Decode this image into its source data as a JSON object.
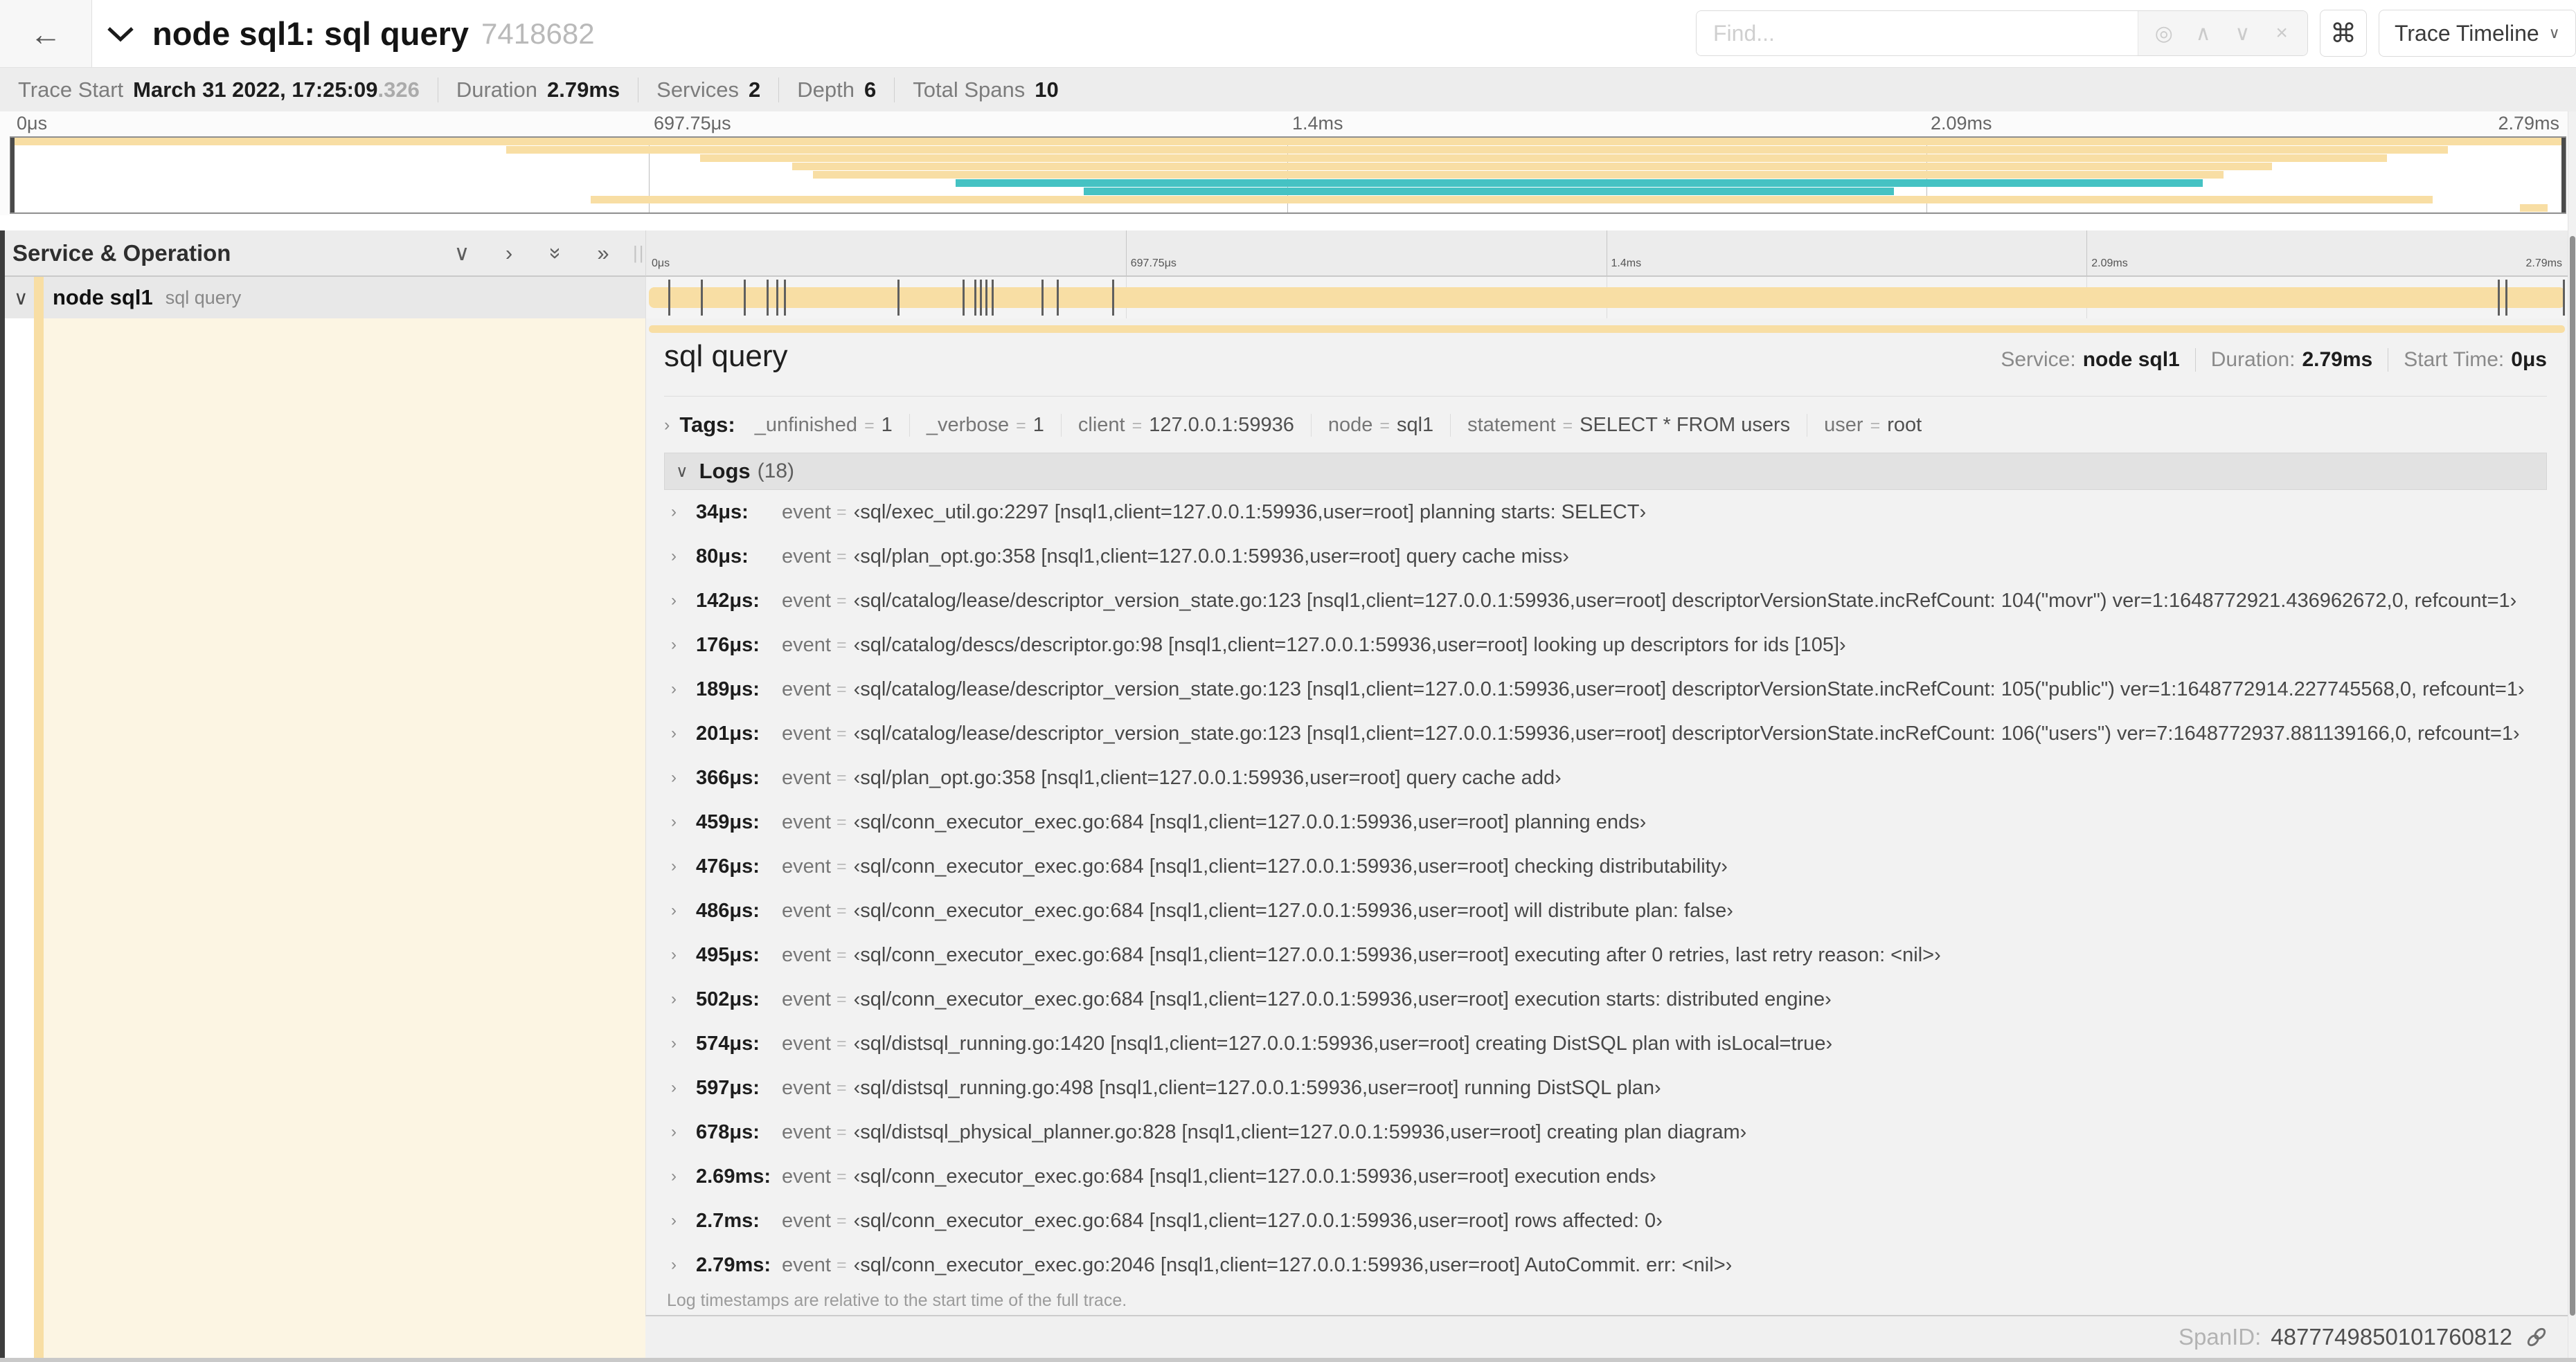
{
  "colors": {
    "tan": "#F8DEA4",
    "teal": "#45C2C3",
    "cream": "#FCF5E3"
  },
  "icons": {
    "back": "←",
    "chevron_down": "∨",
    "chevron_right": "›",
    "double_chevron_right": "»",
    "target": "◎",
    "up": "∧",
    "down": "∨",
    "close": "×",
    "command": "⌘",
    "caret": "∨",
    "grip": "||"
  },
  "header": {
    "title": "node sql1: sql query",
    "trace_id": "7418682",
    "find_placeholder": "Find...",
    "view_selector": "Trace Timeline"
  },
  "summary": {
    "items": [
      {
        "label": "Trace Start",
        "value": "March 31 2022, 17:25:09",
        "suffix": ".326"
      },
      {
        "label": "Duration",
        "value": "2.79ms"
      },
      {
        "label": "Services",
        "value": "2"
      },
      {
        "label": "Depth",
        "value": "6"
      },
      {
        "label": "Total Spans",
        "value": "10"
      }
    ]
  },
  "timeline": {
    "ticks": [
      {
        "label": "0μs",
        "pct": 0
      },
      {
        "label": "697.75μs",
        "pct": 25
      },
      {
        "label": "1.4ms",
        "pct": 50
      },
      {
        "label": "2.09ms",
        "pct": 75
      },
      {
        "label": "2.79ms",
        "pct": 100
      }
    ],
    "event_marks_pct": [
      1.2,
      2.9,
      5.1,
      6.3,
      6.8,
      7.2,
      13.1,
      16.5,
      17.1,
      17.4,
      17.7,
      18.0,
      20.6,
      21.4,
      24.3,
      96.4,
      96.8,
      99.8
    ]
  },
  "minimap": {
    "spans": [
      {
        "row": 0,
        "start_pct": 0,
        "end_pct": 100,
        "color": "tan"
      },
      {
        "row": 1,
        "start_pct": 19.4,
        "end_pct": 95.4,
        "color": "tan"
      },
      {
        "row": 2,
        "start_pct": 27,
        "end_pct": 93,
        "color": "tan"
      },
      {
        "row": 3,
        "start_pct": 30.6,
        "end_pct": 88.5,
        "color": "tan"
      },
      {
        "row": 4,
        "start_pct": 31.4,
        "end_pct": 86.6,
        "color": "tan"
      },
      {
        "row": 5,
        "start_pct": 37,
        "end_pct": 85.8,
        "color": "teal"
      },
      {
        "row": 6,
        "start_pct": 42,
        "end_pct": 73.7,
        "color": "teal"
      },
      {
        "row": 7,
        "start_pct": 22.7,
        "end_pct": 94.8,
        "color": "tan"
      },
      {
        "row": 8,
        "start_pct": 98.2,
        "end_pct": 99.3,
        "color": "tan"
      }
    ]
  },
  "table_header": {
    "label": "Service & Operation"
  },
  "span_row": {
    "service": "node sql1",
    "operation": "sql query"
  },
  "detail": {
    "operation": "sql query",
    "service_label": "Service:",
    "service": "node sql1",
    "duration_label": "Duration:",
    "duration": "2.79ms",
    "start_label": "Start Time:",
    "start": "0μs",
    "tags_label": "Tags:",
    "tags": [
      {
        "key": "_unfinished",
        "value": "1"
      },
      {
        "key": "_verbose",
        "value": "1"
      },
      {
        "key": "client",
        "value": "127.0.0.1:59936"
      },
      {
        "key": "node",
        "value": "sql1"
      },
      {
        "key": "statement",
        "value": "SELECT * FROM users"
      },
      {
        "key": "user",
        "value": "root"
      }
    ],
    "logs_label": "Logs",
    "logs_count": "(18)",
    "logs": [
      {
        "time": "34μs:",
        "field": "event",
        "value": "‹sql/exec_util.go:2297 [nsql1,client=127.0.0.1:59936,user=root] planning starts: SELECT›"
      },
      {
        "time": "80μs:",
        "field": "event",
        "value": "‹sql/plan_opt.go:358 [nsql1,client=127.0.0.1:59936,user=root] query cache miss›"
      },
      {
        "time": "142μs:",
        "field": "event",
        "value": "‹sql/catalog/lease/descriptor_version_state.go:123 [nsql1,client=127.0.0.1:59936,user=root] descriptorVersionState.incRefCount: 104(\"movr\") ver=1:1648772921.436962672,0, refcount=1›"
      },
      {
        "time": "176μs:",
        "field": "event",
        "value": "‹sql/catalog/descs/descriptor.go:98 [nsql1,client=127.0.0.1:59936,user=root] looking up descriptors for ids [105]›"
      },
      {
        "time": "189μs:",
        "field": "event",
        "value": "‹sql/catalog/lease/descriptor_version_state.go:123 [nsql1,client=127.0.0.1:59936,user=root] descriptorVersionState.incRefCount: 105(\"public\") ver=1:1648772914.227745568,0, refcount=1›"
      },
      {
        "time": "201μs:",
        "field": "event",
        "value": "‹sql/catalog/lease/descriptor_version_state.go:123 [nsql1,client=127.0.0.1:59936,user=root] descriptorVersionState.incRefCount: 106(\"users\") ver=7:1648772937.881139166,0, refcount=1›"
      },
      {
        "time": "366μs:",
        "field": "event",
        "value": "‹sql/plan_opt.go:358 [nsql1,client=127.0.0.1:59936,user=root] query cache add›"
      },
      {
        "time": "459μs:",
        "field": "event",
        "value": "‹sql/conn_executor_exec.go:684 [nsql1,client=127.0.0.1:59936,user=root] planning ends›"
      },
      {
        "time": "476μs:",
        "field": "event",
        "value": "‹sql/conn_executor_exec.go:684 [nsql1,client=127.0.0.1:59936,user=root] checking distributability›"
      },
      {
        "time": "486μs:",
        "field": "event",
        "value": "‹sql/conn_executor_exec.go:684 [nsql1,client=127.0.0.1:59936,user=root] will distribute plan: false›"
      },
      {
        "time": "495μs:",
        "field": "event",
        "value": "‹sql/conn_executor_exec.go:684 [nsql1,client=127.0.0.1:59936,user=root] executing after 0 retries, last retry reason: <nil>›"
      },
      {
        "time": "502μs:",
        "field": "event",
        "value": "‹sql/conn_executor_exec.go:684 [nsql1,client=127.0.0.1:59936,user=root] execution starts: distributed engine›"
      },
      {
        "time": "574μs:",
        "field": "event",
        "value": "‹sql/distsql_running.go:1420 [nsql1,client=127.0.0.1:59936,user=root] creating DistSQL plan with isLocal=true›"
      },
      {
        "time": "597μs:",
        "field": "event",
        "value": "‹sql/distsql_running.go:498 [nsql1,client=127.0.0.1:59936,user=root] running DistSQL plan›"
      },
      {
        "time": "678μs:",
        "field": "event",
        "value": "‹sql/distsql_physical_planner.go:828 [nsql1,client=127.0.0.1:59936,user=root] creating plan diagram›"
      },
      {
        "time": "2.69ms:",
        "field": "event",
        "value": "‹sql/conn_executor_exec.go:684 [nsql1,client=127.0.0.1:59936,user=root] execution ends›"
      },
      {
        "time": "2.7ms:",
        "field": "event",
        "value": "‹sql/conn_executor_exec.go:684 [nsql1,client=127.0.0.1:59936,user=root] rows affected: 0›"
      },
      {
        "time": "2.79ms:",
        "field": "event",
        "value": "‹sql/conn_executor_exec.go:2046 [nsql1,client=127.0.0.1:59936,user=root] AutoCommit. err: <nil>›"
      }
    ],
    "logs_note": "Log timestamps are relative to the start time of the full trace.",
    "spanid_label": "SpanID:",
    "spanid": "4877749850101760812"
  }
}
